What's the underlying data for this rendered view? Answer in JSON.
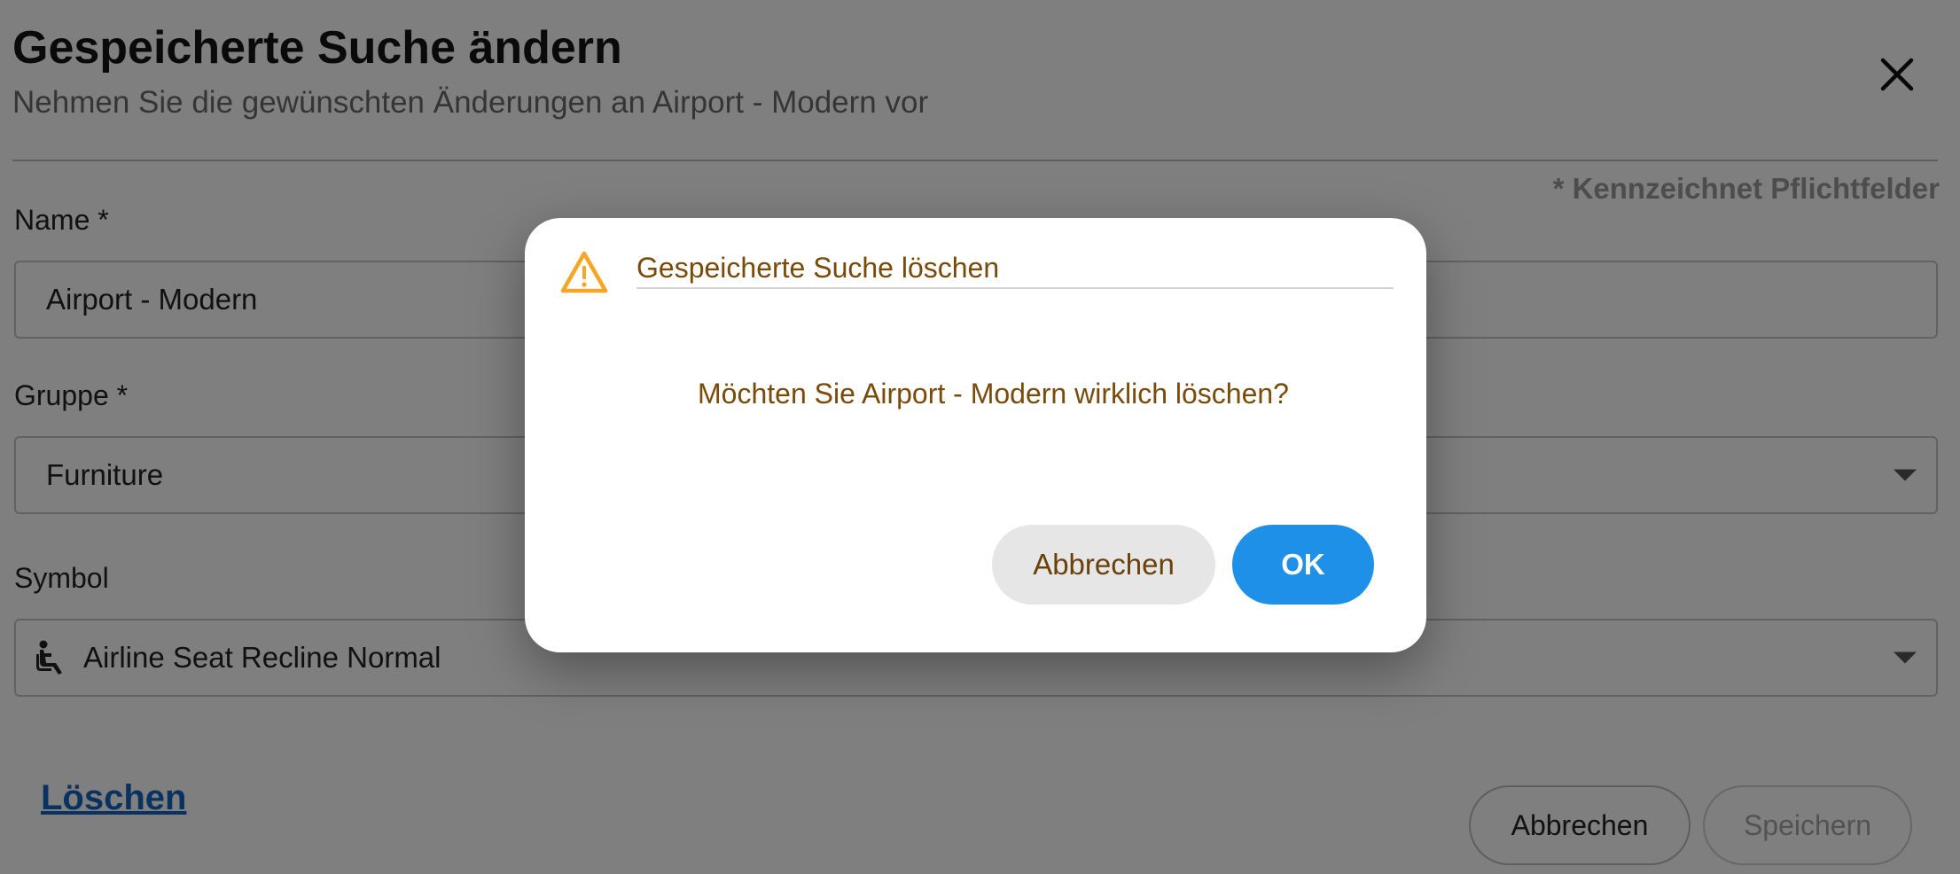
{
  "form": {
    "title": "Gespeicherte Suche ändern",
    "subtitle": "Nehmen Sie die gewünschten Änderungen an Airport - Modern vor",
    "required_note": "* Kennzeichnet Pflichtfelder",
    "name_label": "Name *",
    "name_value": "Airport - Modern",
    "group_label": "Gruppe *",
    "group_value": "Furniture",
    "symbol_label": "Symbol",
    "symbol_value": "Airline Seat Recline Normal",
    "symbol_icon": "airline-seat-recline-normal-icon",
    "delete_link": "Löschen",
    "cancel_label": "Abbrechen",
    "save_label": "Speichern"
  },
  "dialog": {
    "title": "Gespeicherte Suche löschen",
    "message": "Möchten Sie Airport - Modern wirklich löschen?",
    "cancel_label": "Abbrechen",
    "ok_label": "OK",
    "icon": "warning-icon"
  },
  "colors": {
    "accent": "#1e90e8",
    "link": "#1565c0",
    "warning": "#f5a623",
    "dialog_text": "#7a4a0a"
  }
}
